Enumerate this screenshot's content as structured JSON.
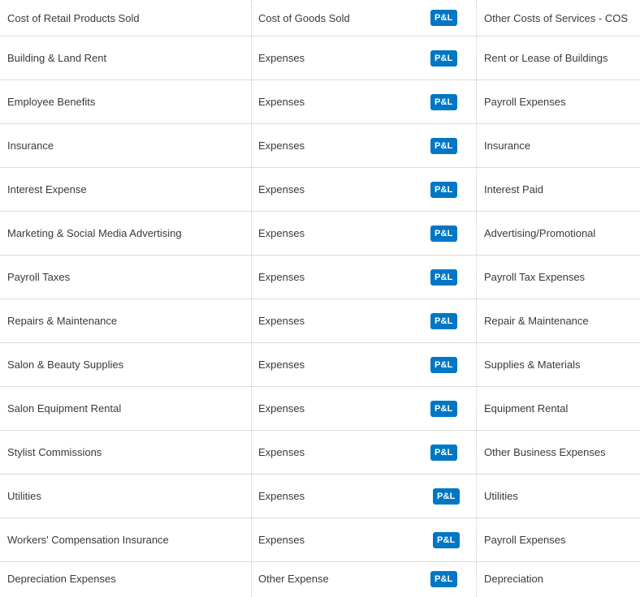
{
  "rows": [
    {
      "account": "Cost of Retail Products Sold",
      "type": "Cost of Goods Sold",
      "badge": "P&L",
      "mapped": "Other Costs of Services - COS"
    },
    {
      "account": "Building & Land Rent",
      "type": "Expenses",
      "badge": "P&L",
      "mapped": "Rent or Lease of Buildings"
    },
    {
      "account": "Employee Benefits",
      "type": "Expenses",
      "badge": "P&L",
      "mapped": "Payroll Expenses"
    },
    {
      "account": "Insurance",
      "type": "Expenses",
      "badge": "P&L",
      "mapped": "Insurance"
    },
    {
      "account": "Interest Expense",
      "type": "Expenses",
      "badge": "P&L",
      "mapped": "Interest Paid"
    },
    {
      "account": "Marketing & Social Media Advertising",
      "type": "Expenses",
      "badge": "P&L",
      "mapped": "Advertising/Promotional"
    },
    {
      "account": "Payroll Taxes",
      "type": "Expenses",
      "badge": "P&L",
      "mapped": "Payroll Tax Expenses"
    },
    {
      "account": "Repairs & Maintenance",
      "type": "Expenses",
      "badge": "P&L",
      "mapped": "Repair & Maintenance"
    },
    {
      "account": "Salon & Beauty Supplies",
      "type": "Expenses",
      "badge": "P&L",
      "mapped": "Supplies & Materials"
    },
    {
      "account": "Salon Equipment Rental",
      "type": "Expenses",
      "badge": "P&L",
      "mapped": "Equipment Rental"
    },
    {
      "account": "Stylist Commissions",
      "type": "Expenses",
      "badge": "P&L",
      "mapped": "Other Business Expenses"
    },
    {
      "account": "Utilities",
      "type": "Expenses",
      "badge": "P&L",
      "mapped": "Utilities"
    },
    {
      "account": "Workers' Compensation Insurance",
      "type": "Expenses",
      "badge": "P&L",
      "mapped": "Payroll Expenses"
    },
    {
      "account": "Depreciation Expenses",
      "type": "Other Expense",
      "badge": "P&L",
      "mapped": "Depreciation"
    }
  ],
  "colors": {
    "badge_bg": "#0077c5",
    "badge_text": "#ffffff",
    "text": "#393a3d",
    "divider": "#dcdcdc"
  }
}
